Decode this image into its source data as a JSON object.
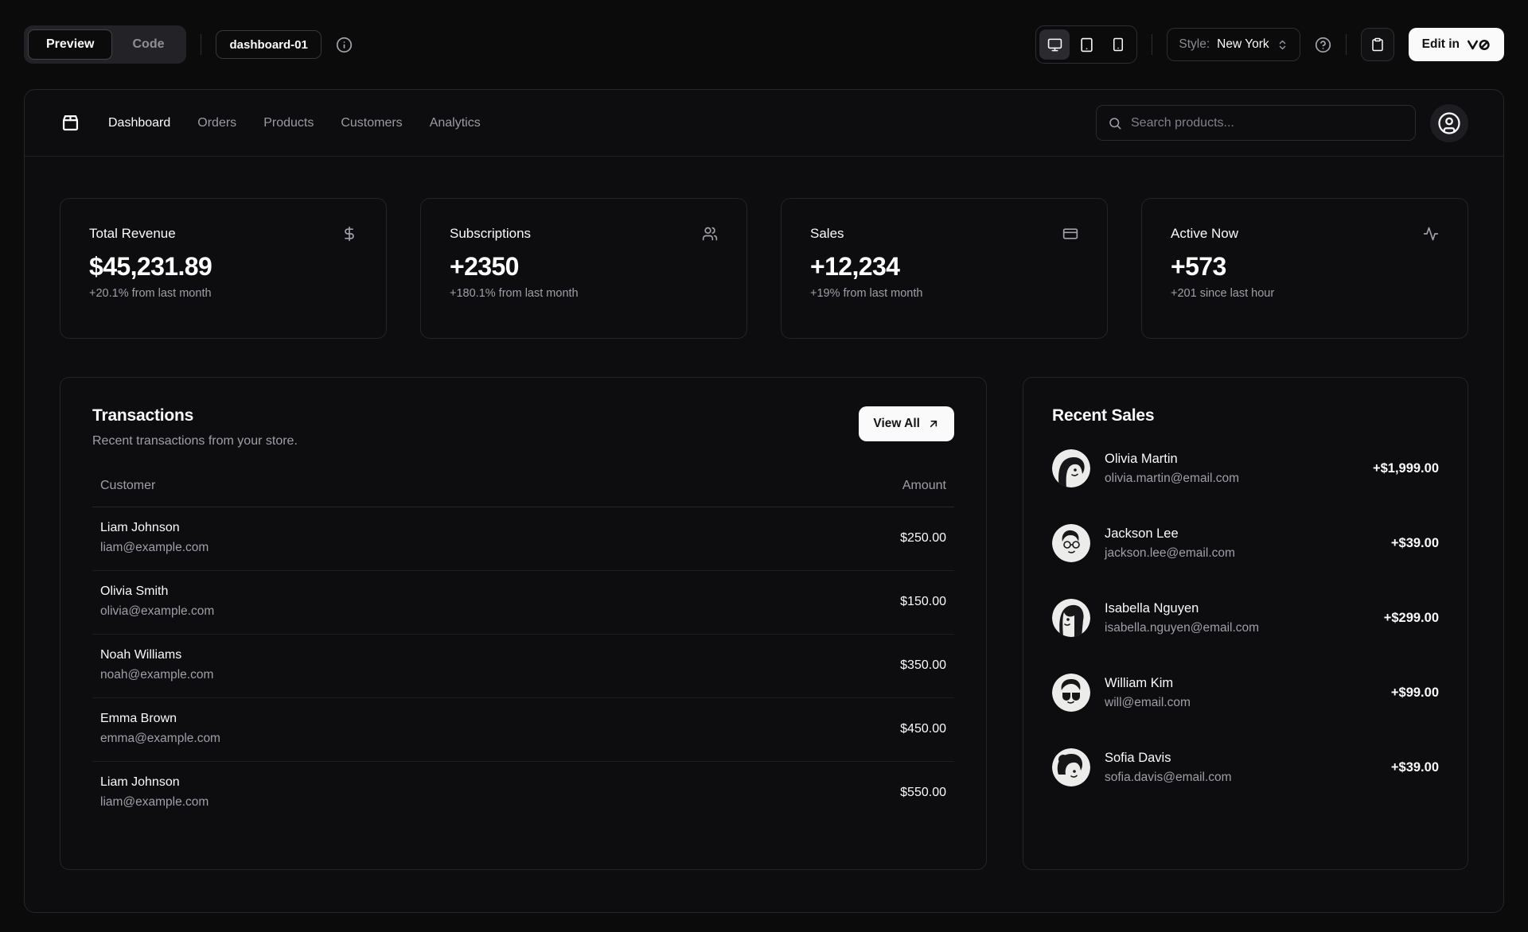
{
  "toolbar": {
    "preview_label": "Preview",
    "code_label": "Code",
    "block_name": "dashboard-01",
    "style_label": "Style:",
    "style_value": "New York",
    "edit_button_label": "Edit in"
  },
  "nav": {
    "items": [
      "Dashboard",
      "Orders",
      "Products",
      "Customers",
      "Analytics"
    ],
    "search_placeholder": "Search products..."
  },
  "stats": {
    "cards": [
      {
        "title": "Total Revenue",
        "value": "$45,231.89",
        "change": "+20.1% from last month",
        "icon": "dollar-sign"
      },
      {
        "title": "Subscriptions",
        "value": "+2350",
        "change": "+180.1% from last month",
        "icon": "users"
      },
      {
        "title": "Sales",
        "value": "+12,234",
        "change": "+19% from last month",
        "icon": "credit-card"
      },
      {
        "title": "Active Now",
        "value": "+573",
        "change": "+201 since last hour",
        "icon": "activity"
      }
    ]
  },
  "transactions": {
    "title": "Transactions",
    "subtitle": "Recent transactions from your store.",
    "view_all_label": "View All",
    "columns": {
      "customer": "Customer",
      "amount": "Amount"
    },
    "rows": [
      {
        "name": "Liam Johnson",
        "email": "liam@example.com",
        "amount": "$250.00"
      },
      {
        "name": "Olivia Smith",
        "email": "olivia@example.com",
        "amount": "$150.00"
      },
      {
        "name": "Noah Williams",
        "email": "noah@example.com",
        "amount": "$350.00"
      },
      {
        "name": "Emma Brown",
        "email": "emma@example.com",
        "amount": "$450.00"
      },
      {
        "name": "Liam Johnson",
        "email": "liam@example.com",
        "amount": "$550.00"
      }
    ]
  },
  "recent_sales": {
    "title": "Recent Sales",
    "items": [
      {
        "name": "Olivia Martin",
        "email": "olivia.martin@email.com",
        "amount": "+$1,999.00"
      },
      {
        "name": "Jackson Lee",
        "email": "jackson.lee@email.com",
        "amount": "+$39.00"
      },
      {
        "name": "Isabella Nguyen",
        "email": "isabella.nguyen@email.com",
        "amount": "+$299.00"
      },
      {
        "name": "William Kim",
        "email": "will@email.com",
        "amount": "+$99.00"
      },
      {
        "name": "Sofia Davis",
        "email": "sofia.davis@email.com",
        "amount": "+$39.00"
      }
    ]
  },
  "colors": {
    "page_bg": "#0b0b0c",
    "panel_bg": "#0d0d0f",
    "border": "#26262b",
    "text_primary": "#fafafa",
    "text_muted": "#9f9fa8",
    "button_bg": "#fafafa",
    "button_text": "#141417"
  }
}
